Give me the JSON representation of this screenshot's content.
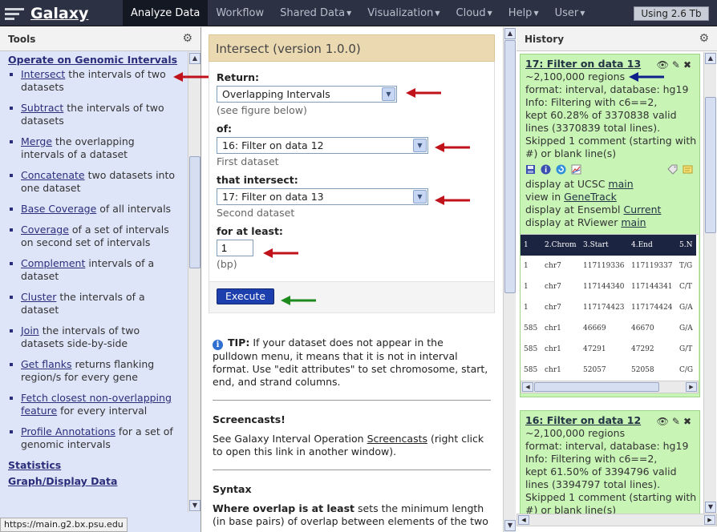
{
  "masthead": {
    "brand": "Galaxy",
    "nav": [
      {
        "label": "Analyze Data",
        "caret": false,
        "active": true
      },
      {
        "label": "Workflow",
        "caret": false,
        "active": false
      },
      {
        "label": "Shared Data",
        "caret": true,
        "active": false
      },
      {
        "label": "Visualization",
        "caret": true,
        "active": false
      },
      {
        "label": "Cloud",
        "caret": true,
        "active": false
      },
      {
        "label": "Help",
        "caret": true,
        "active": false
      },
      {
        "label": "User",
        "caret": true,
        "active": false
      }
    ],
    "quota": "Using 2.6 Tb"
  },
  "tools_panel": {
    "title": "Tools",
    "section_title": "Operate on Genomic Intervals",
    "items": [
      {
        "link": "Intersect",
        "rest": " the intervals of two datasets"
      },
      {
        "link": "Subtract",
        "rest": " the intervals of two datasets"
      },
      {
        "link": "Merge",
        "rest": " the overlapping intervals of a dataset"
      },
      {
        "link": "Concatenate",
        "rest": " two datasets into one dataset"
      },
      {
        "link": "Base Coverage",
        "rest": " of all intervals"
      },
      {
        "link": "Coverage",
        "rest": " of a set of intervals on second set of intervals"
      },
      {
        "link": "Complement",
        "rest": " intervals of a dataset"
      },
      {
        "link": "Cluster",
        "rest": " the intervals of a dataset"
      },
      {
        "link": "Join",
        "rest": " the intervals of two datasets side-by-side"
      },
      {
        "link": "Get flanks",
        "rest": " returns flanking region/s for every gene"
      },
      {
        "link": "Fetch closest non-overlapping feature",
        "rest": " for every interval"
      },
      {
        "link": "Profile Annotations",
        "rest": " for a set of genomic intervals"
      }
    ],
    "next_sections": [
      "Statistics",
      "Graph/Display Data"
    ],
    "status_url": "https://main.g2.bx.psu.edu"
  },
  "tool_form": {
    "title": "Intersect (version 1.0.0)",
    "return_label": "Return:",
    "return_value": "Overlapping Intervals",
    "return_hint": "(see figure below)",
    "of_label": "of:",
    "of_value": "16: Filter on data 12",
    "of_hint": "First dataset",
    "intersect_label": "that intersect:",
    "intersect_value": "17: Filter on data 13",
    "intersect_hint": "Second dataset",
    "atleast_label": "for at least:",
    "atleast_value": "1",
    "atleast_hint": "(bp)",
    "execute_label": "Execute"
  },
  "help": {
    "tip_bold": "TIP:",
    "tip_text": " If your dataset does not appear in the pulldown menu, it means that it is not in interval format. Use \"edit attributes\" to set chromosome, start, end, and strand columns.",
    "screencasts_title": "Screencasts!",
    "screencasts_pre": "See Galaxy Interval Operation ",
    "screencasts_link": "Screencasts",
    "screencasts_post": " (right click to open this link in another window).",
    "syntax_title": "Syntax",
    "syntax_bold": "Where overlap is at least",
    "syntax_text": " sets the minimum length (in base pairs) of overlap between elements of the two"
  },
  "history": {
    "title": "History",
    "datasets": [
      {
        "title": "17: Filter on data 13",
        "regions": "~2,100,000 regions",
        "format": "format: interval, database: hg19",
        "info": [
          "Info: Filtering with c6==2,",
          "kept 60.28% of 3370838 valid",
          "lines (3370839 total lines).",
          "Skipped 1 comment (starting with",
          "#) or blank line(s)"
        ],
        "display_ucsc_pre": "display at UCSC ",
        "display_ucsc_link": "main",
        "view_pre": "view in ",
        "view_link": "GeneTrack",
        "ensembl_pre": "display at Ensembl ",
        "ensembl_link": "Current",
        "rviewer_pre": "display at RViewer ",
        "rviewer_link": "main",
        "peek_headers": [
          "1",
          "2.Chrom",
          "3.Start",
          "4.End",
          "5.N"
        ],
        "peek_rows": [
          [
            "1",
            "chr7",
            "117119336",
            "117119337",
            "T/G"
          ],
          [
            "1",
            "chr7",
            "117144340",
            "117144341",
            "C/T"
          ],
          [
            "1",
            "chr7",
            "117174423",
            "117174424",
            "G/A"
          ],
          [
            "585",
            "chr1",
            "46669",
            "46670",
            "G/A"
          ],
          [
            "585",
            "chr1",
            "47291",
            "47292",
            "G/T"
          ],
          [
            "585",
            "chr1",
            "52057",
            "52058",
            "C/G"
          ]
        ]
      },
      {
        "title": "16: Filter on data 12",
        "regions": "~2,100,000 regions",
        "format": "format: interval, database: hg19",
        "info": [
          "Info: Filtering with c6==2,",
          "kept 61.50% of 3394796 valid",
          "lines (3394797 total lines).",
          "Skipped 1 comment (starting with",
          "#) or blank line(s)"
        ]
      }
    ]
  },
  "colors": {
    "masthead": "#2c3143",
    "tool_panel_bg": "#dfe5f9",
    "form_title_bg": "#ebd9b2",
    "dataset_ok_bg": "#c8f4b6",
    "execute_button": "#1d3fae",
    "arrow_red": "#c0121a",
    "arrow_green": "#1c8a1c",
    "arrow_blue": "#10208a"
  }
}
